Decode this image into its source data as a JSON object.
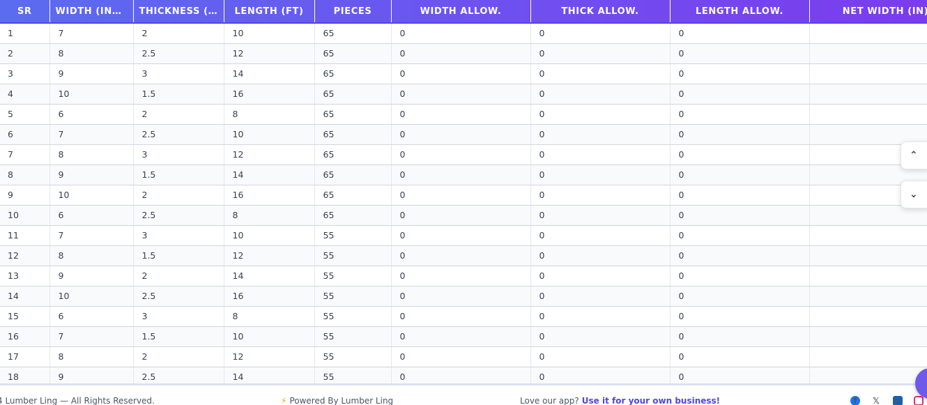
{
  "table": {
    "headers": [
      "SR",
      "WIDTH (INC…",
      "THICKNESS (I…",
      "LENGTH (FT)",
      "PIECES",
      "WIDTH ALLOW.",
      "THICK ALLOW.",
      "LENGTH ALLOW.",
      "NET WIDTH (IN)"
    ],
    "rows": [
      [
        "1",
        "7",
        "2",
        "10",
        "65",
        "0",
        "0",
        "0",
        ""
      ],
      [
        "2",
        "8",
        "2.5",
        "12",
        "65",
        "0",
        "0",
        "0",
        ""
      ],
      [
        "3",
        "9",
        "3",
        "14",
        "65",
        "0",
        "0",
        "0",
        ""
      ],
      [
        "4",
        "10",
        "1.5",
        "16",
        "65",
        "0",
        "0",
        "0",
        ""
      ],
      [
        "5",
        "6",
        "2",
        "8",
        "65",
        "0",
        "0",
        "0",
        ""
      ],
      [
        "6",
        "7",
        "2.5",
        "10",
        "65",
        "0",
        "0",
        "0",
        ""
      ],
      [
        "7",
        "8",
        "3",
        "12",
        "65",
        "0",
        "0",
        "0",
        ""
      ],
      [
        "8",
        "9",
        "1.5",
        "14",
        "65",
        "0",
        "0",
        "0",
        ""
      ],
      [
        "9",
        "10",
        "2",
        "16",
        "65",
        "0",
        "0",
        "0",
        ""
      ],
      [
        "10",
        "6",
        "2.5",
        "8",
        "65",
        "0",
        "0",
        "0",
        ""
      ],
      [
        "11",
        "7",
        "3",
        "10",
        "55",
        "0",
        "0",
        "0",
        ""
      ],
      [
        "12",
        "8",
        "1.5",
        "12",
        "55",
        "0",
        "0",
        "0",
        ""
      ],
      [
        "13",
        "9",
        "2",
        "14",
        "55",
        "0",
        "0",
        "0",
        ""
      ],
      [
        "14",
        "10",
        "2.5",
        "16",
        "55",
        "0",
        "0",
        "0",
        ""
      ],
      [
        "15",
        "6",
        "3",
        "8",
        "55",
        "0",
        "0",
        "0",
        ""
      ],
      [
        "16",
        "7",
        "1.5",
        "10",
        "55",
        "0",
        "0",
        "0",
        ""
      ],
      [
        "17",
        "8",
        "2",
        "12",
        "55",
        "0",
        "0",
        "0",
        ""
      ],
      [
        "18",
        "9",
        "2.5",
        "14",
        "55",
        "0",
        "0",
        "0",
        ""
      ]
    ]
  },
  "footer": {
    "copyright": "4 Lumber Ling — All Rights Reserved.",
    "powered_icon": "⚡",
    "powered": "Powered By Lumber Ling",
    "love": "Love our app?",
    "cta": "Use it for your own business!"
  },
  "social": {
    "facebook": "f",
    "twitter": "𝕏",
    "linkedin": "in"
  },
  "scroll": {
    "up": "⌃",
    "down": "⌄"
  },
  "colors": {
    "header_start": "#5b6cf0",
    "header_end": "#7c3aed",
    "accent": "#4f46e5"
  }
}
